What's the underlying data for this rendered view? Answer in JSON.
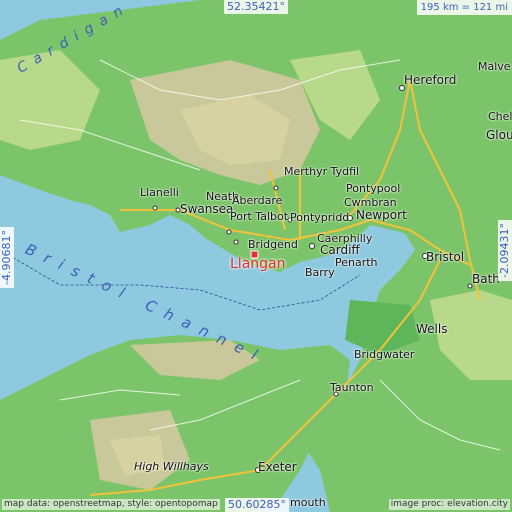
{
  "coords": {
    "top": "52.35421°",
    "bottom": "50.60285°",
    "left": "-4.90681°",
    "right": "-2.09431°"
  },
  "scale": "195 km = 121 mi",
  "credits": {
    "left": "map data: openstreetmap, style: opentopomap",
    "right": "image proc: elevation.city"
  },
  "main_place": "Llangan",
  "places": [
    "Hereford",
    "Malvern",
    "Cheltenham",
    "Gloucester",
    "Merthyr Tydfil",
    "Pontypool",
    "Cwmbran",
    "Llanelli",
    "Neath",
    "Aberdare",
    "Swansea",
    "Port Talbot",
    "Pontypridd",
    "Newport",
    "Caerphilly",
    "Bridgend",
    "Cardiff",
    "Penarth",
    "Barry",
    "Bristol",
    "Bath",
    "Wells",
    "Bridgwater",
    "Taunton",
    "Exeter",
    "High Willhays",
    "Exmouth"
  ],
  "water_labels": {
    "bristol_channel": "Bristol Channel",
    "cardigan_bay": "Cardigan"
  },
  "place_labels": {
    "hereford": "Hereford",
    "malvern": "Malve",
    "cheltenham": "Chelt",
    "gloucester": "Glou",
    "merthyr": "Merthyr Tydfil",
    "pontypool": "Pontypool",
    "cwmbran": "Cwmbran",
    "llanelli": "Llanelli",
    "neath": "Neath",
    "aberdare": "Aberdare",
    "swansea": "Swansea",
    "port_talbot": "Port Talbot",
    "pontypridd": "Pontypridd",
    "newport": "Newport",
    "caerphilly": "Caerphilly",
    "bridgend": "Bridgend",
    "cardiff": "Cardiff",
    "penarth": "Penarth",
    "barry": "Barry",
    "bristol": "Bristol",
    "bath": "Bath",
    "wells": "Wells",
    "bridgwater": "Bridgwater",
    "taunton": "Taunton",
    "exeter": "Exeter",
    "high_willhays": "High Willhays",
    "exmouth": "mouth"
  },
  "colors": {
    "sea": "#8fc9e0",
    "lowland": "#7cc46a",
    "mid": "#b8d98a",
    "upland": "#d8d2a0",
    "highland": "#c8b890",
    "road_major": "#f2c23a",
    "road_minor": "#ffffff",
    "marker": "#e03030",
    "water_text": "#3b5fb8"
  }
}
